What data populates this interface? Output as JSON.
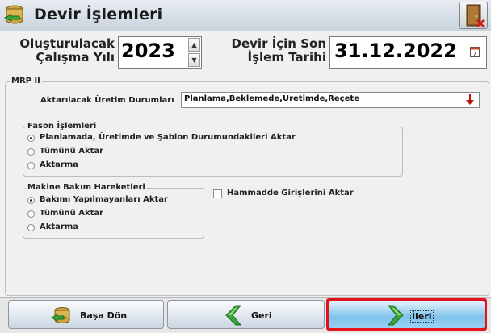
{
  "window": {
    "title": "Devir İşlemleri"
  },
  "fields": {
    "year_label_line1": "Oluşturulacak",
    "year_label_line2": "Çalışma Yılı",
    "year_value": "2023",
    "date_label_line1": "Devir İçin Son",
    "date_label_line2": "İşlem Tarihi",
    "date_value": "31.12.2022",
    "calendar_day": "7"
  },
  "mrp": {
    "group_title": "MRP II",
    "production_status_label": "Aktarılacak Üretim Durumları",
    "production_status_value": "Planlama,Beklemede,Üretimde,Reçete",
    "fason": {
      "title": "Fason İşlemleri",
      "options": [
        "Planlamada, Üretimde ve Şablon Durumundakileri Aktar",
        "Tümünü Aktar",
        "Aktarma"
      ],
      "selected_index": 0
    },
    "maintenance": {
      "title": "Makine Bakım Hareketleri",
      "options": [
        "Bakımı Yapılmayanları Aktar",
        "Tümünü Aktar",
        "Aktarma"
      ],
      "selected_index": 0
    },
    "raw_material_checkbox_label": "Hammadde Girişlerini Aktar",
    "raw_material_checked": false
  },
  "buttons": {
    "restart_label": "Başa Dön",
    "back_label": "Geri",
    "next_label": "İleri"
  },
  "colors": {
    "highlight_frame": "#e3121c",
    "arrow_green": "#3aa63a"
  }
}
